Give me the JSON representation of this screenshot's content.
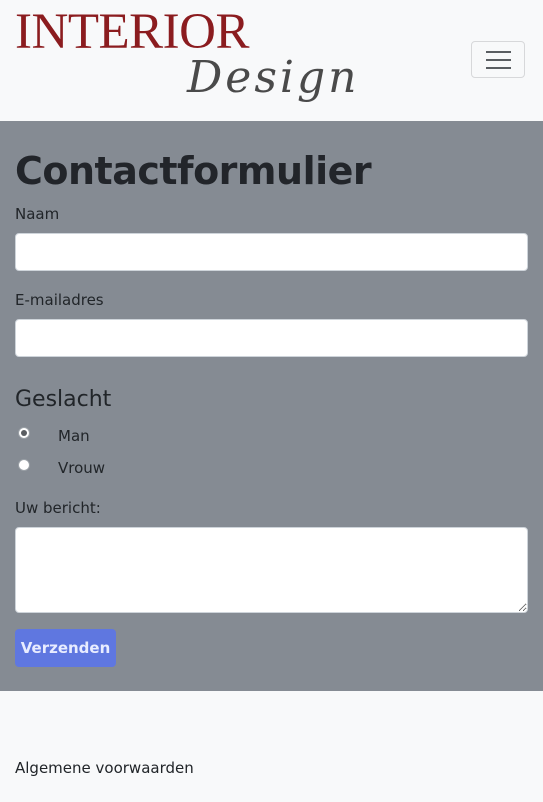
{
  "brand": {
    "logo_line1": "INTERIOR",
    "logo_line2": "Design",
    "logo_primary_color": "#8b1c1f"
  },
  "navbar": {
    "toggler_icon": "hamburger-menu-icon"
  },
  "form": {
    "title": "Contactformulier",
    "name_label": "Naam",
    "name_value": "",
    "email_label": "E-mailadres",
    "email_value": "",
    "gender_heading": "Geslacht",
    "gender_options": [
      {
        "label": "Man",
        "selected": true
      },
      {
        "label": "Vrouw",
        "selected": false
      }
    ],
    "message_label": "Uw bericht:",
    "message_value": "",
    "submit_label": "Verzenden",
    "section_background": "#858b93",
    "submit_color": "#5f77e0"
  },
  "footer": {
    "terms_link": "Algemene voorwaarden"
  }
}
